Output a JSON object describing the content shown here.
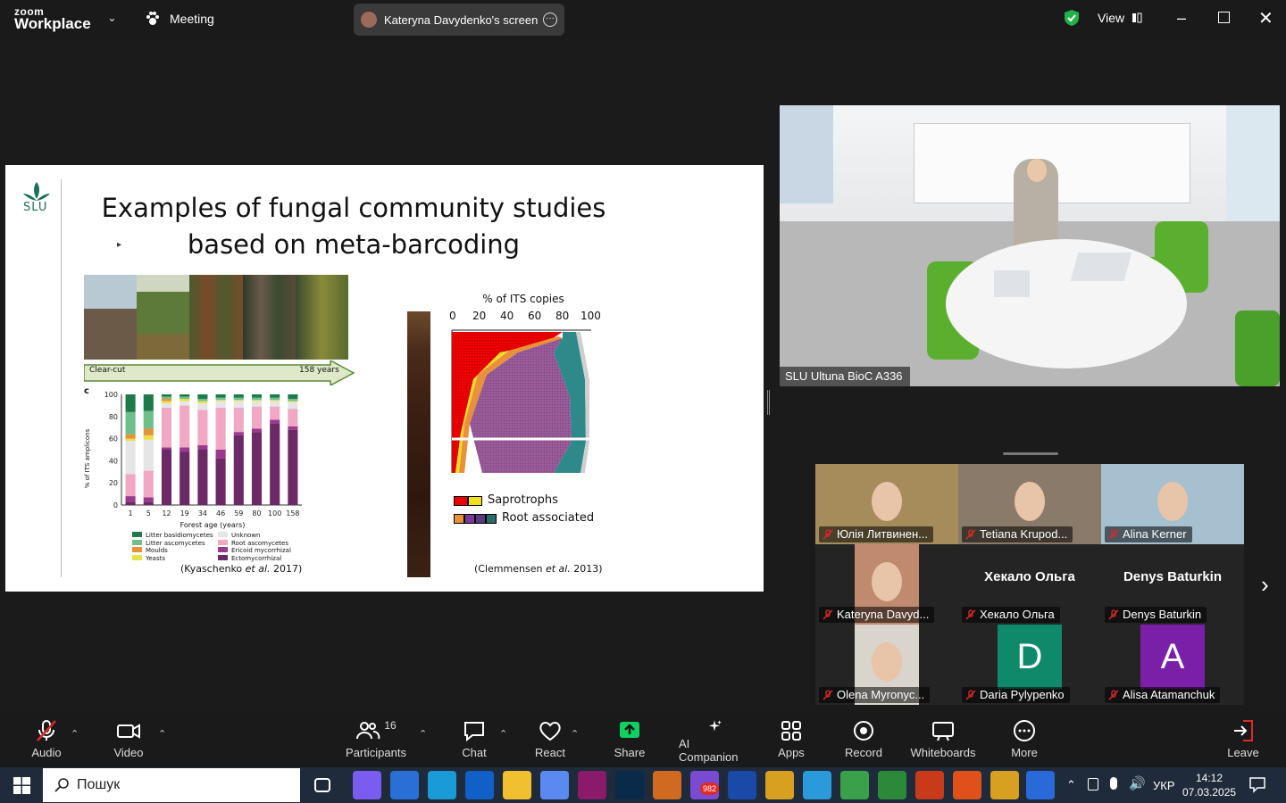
{
  "titlebar": {
    "brand_top": "zoom",
    "brand_bottom": "Workplace",
    "meeting_label": "Meeting",
    "screen_share_label": "Kateryna Davydenko's screen",
    "view_label": "View"
  },
  "slide": {
    "logo": "SLU",
    "title_line1": "Examples of fungal community studies",
    "title_line2": "based on meta-barcoding",
    "arrow_left": "Clear-cut",
    "arrow_right": "158 years",
    "panel_c": "c",
    "left_ylabel": "% of ITS amplicons",
    "left_xlabel": "Forest age (years)",
    "left_y_ticks": [
      "100",
      "80",
      "60",
      "40",
      "20",
      "0"
    ],
    "left_x_ticks": [
      "1",
      "5",
      "12",
      "19",
      "34",
      "46",
      "59",
      "80",
      "100",
      "158"
    ],
    "legend_left": [
      "Litter basidiomycetes",
      "Litter ascomycetes",
      "Moulds",
      "Yeasts"
    ],
    "legend_right": [
      "Unknown",
      "Root ascomycetes",
      "Ericoid mycorrhizal",
      "Ectomycorrhizal"
    ],
    "cite_left_a": "(Kyaschenko ",
    "cite_left_b": "et al.",
    "cite_left_c": " 2017)",
    "right_title": "% of ITS copies",
    "right_x_ticks": [
      "0",
      "20",
      "40",
      "60",
      "80",
      "100"
    ],
    "legend_sap": "Saprotrophs",
    "legend_root": "Root associated",
    "cite_right_a": "(Clemmensen ",
    "cite_right_b": "et al.",
    "cite_right_c": " 2013)"
  },
  "chart_data": {
    "type": "bar",
    "title": "",
    "xlabel": "Forest age (years)",
    "ylabel": "% of ITS amplicons",
    "ylim": [
      0,
      100
    ],
    "categories": [
      "1",
      "5",
      "12",
      "19",
      "34",
      "46",
      "59",
      "80",
      "100",
      "158"
    ],
    "series": [
      {
        "name": "Ectomycorrhizal",
        "values": [
          3,
          3,
          50,
          48,
          50,
          42,
          63,
          66,
          74,
          68
        ]
      },
      {
        "name": "Ericoid mycorrhizal",
        "values": [
          5,
          4,
          2,
          4,
          4,
          8,
          3,
          3,
          3,
          3
        ]
      },
      {
        "name": "Root ascomycetes",
        "values": [
          20,
          24,
          36,
          38,
          32,
          38,
          22,
          20,
          12,
          16
        ]
      },
      {
        "name": "Unknown",
        "values": [
          30,
          28,
          4,
          4,
          6,
          6,
          6,
          5,
          5,
          6
        ]
      },
      {
        "name": "Yeasts",
        "values": [
          2,
          4,
          2,
          2,
          2,
          1,
          1,
          1,
          1,
          1
        ]
      },
      {
        "name": "Moulds",
        "values": [
          4,
          6,
          2,
          0,
          0,
          0,
          0,
          0,
          0,
          0
        ]
      },
      {
        "name": "Litter ascomycetes",
        "values": [
          20,
          16,
          2,
          2,
          2,
          2,
          2,
          2,
          2,
          2
        ]
      },
      {
        "name": "Litter basidiomycetes",
        "values": [
          16,
          15,
          2,
          2,
          4,
          3,
          3,
          3,
          3,
          4
        ]
      }
    ],
    "colors": [
      "#6b2a66",
      "#9a3a8f",
      "#f0a8c4",
      "#e5e5e5",
      "#e8e04a",
      "#e8903a",
      "#6fbf8a",
      "#1f7a4a"
    ]
  },
  "main_video": {
    "label": "SLU Ultuna BioC A336"
  },
  "participants": [
    {
      "name": "Юлія Литвинен...",
      "type": "photo",
      "bg": "#a58c5a"
    },
    {
      "name": "Tetiana Krupod...",
      "type": "photo",
      "bg": "#8a7a6a"
    },
    {
      "name": "Alina Kerner",
      "type": "photo",
      "bg": "#a6c0d0"
    },
    {
      "name": "Kateryna Davyd...",
      "type": "photo",
      "bg": "#c08a70"
    },
    {
      "name": "Хекало Ольга",
      "type": "name",
      "big": "Хекало Ольга"
    },
    {
      "name": "Denys Baturkin",
      "type": "name",
      "big": "Denys Baturkin"
    },
    {
      "name": "Olena Myronyc...",
      "type": "photo",
      "bg": "#d9d4cc"
    },
    {
      "name": "Daria Pylypenko",
      "type": "avatar",
      "letter": "D",
      "bg": "#0e8a6a"
    },
    {
      "name": "Alisa Atamanchuk",
      "type": "avatar",
      "letter": "A",
      "bg": "#7a1fa8"
    }
  ],
  "toolbar": {
    "audio": "Audio",
    "video": "Video",
    "participants": "Participants",
    "participants_count": "16",
    "chat": "Chat",
    "react": "React",
    "share": "Share",
    "ai": "AI Companion",
    "apps": "Apps",
    "record": "Record",
    "whiteboards": "Whiteboards",
    "more": "More",
    "leave": "Leave"
  },
  "taskbar": {
    "search_placeholder": "Пошук",
    "viber_badge": "982",
    "lang": "УКР",
    "time": "14:12",
    "date": "07.03.2025"
  },
  "colors": {
    "zoom_blue": "#0b5cff",
    "share_green": "#0fd160",
    "leave_red": "#e02828",
    "mute_red": "#e02828",
    "shield_green": "#22b14c"
  }
}
